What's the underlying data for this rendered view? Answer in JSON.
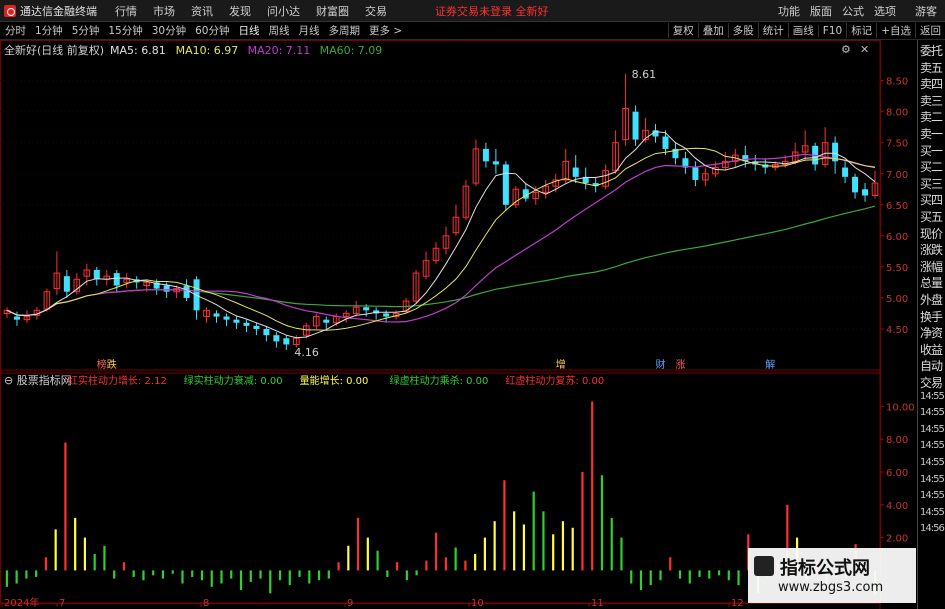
{
  "menubar": {
    "app_name": "通达信金融终端",
    "items": [
      "行情",
      "市场",
      "资讯",
      "发现",
      "问小达",
      "财富圈",
      "交易"
    ],
    "warning": "证券交易未登录 全新好",
    "right_items": [
      "功能",
      "版面",
      "公式",
      "选项"
    ],
    "guest": "游客"
  },
  "toolbar": {
    "timeframes": [
      "分时",
      "1分钟",
      "5分钟",
      "15分钟",
      "30分钟",
      "60分钟",
      "日线",
      "周线",
      "月线",
      "多周期",
      "更多 >"
    ],
    "active": "日线",
    "right_buttons": [
      "复权",
      "叠加",
      "多股",
      "统计",
      "画线",
      "F10",
      "标记",
      "+自选",
      "返回"
    ]
  },
  "chart_data": [
    {
      "type": "candlestick",
      "title": "全新好(日线 前复权)",
      "legend": [
        {
          "name": "MA5",
          "value": "6.81",
          "color": "#e0e0e0"
        },
        {
          "name": "MA10",
          "value": "6.97",
          "color": "#e6e65a"
        },
        {
          "name": "MA20",
          "value": "7.11",
          "color": "#c03ccf"
        },
        {
          "name": "MA60",
          "value": "7.09",
          "color": "#3ca83c"
        }
      ],
      "ylim": [
        4.0,
        8.8
      ],
      "yticks": [
        "8.50",
        "8.00",
        "7.50",
        "7.00",
        "6.50",
        "6.00",
        "5.50",
        "5.00",
        "4.50"
      ],
      "annotations": [
        {
          "text": "8.61"
        },
        {
          "text": "4.16"
        }
      ],
      "event_labels": [
        "榜",
        "跌",
        "增",
        "财",
        "涨",
        "解"
      ],
      "candles": [
        [
          4.75,
          4.8,
          4.68,
          4.85
        ],
        [
          4.7,
          4.65,
          4.55,
          4.78
        ],
        [
          4.65,
          4.7,
          4.6,
          4.8
        ],
        [
          4.72,
          4.8,
          4.65,
          4.85
        ],
        [
          4.82,
          5.1,
          4.78,
          5.15
        ],
        [
          5.15,
          5.4,
          5.05,
          5.75
        ],
        [
          5.35,
          5.1,
          5.0,
          5.45
        ],
        [
          5.1,
          5.3,
          5.05,
          5.4
        ],
        [
          5.35,
          5.45,
          5.2,
          5.55
        ],
        [
          5.45,
          5.3,
          5.2,
          5.5
        ],
        [
          5.3,
          5.35,
          5.2,
          5.45
        ],
        [
          5.4,
          5.2,
          5.1,
          5.45
        ],
        [
          5.25,
          5.3,
          5.15,
          5.4
        ],
        [
          5.3,
          5.25,
          5.15,
          5.35
        ],
        [
          5.2,
          5.25,
          5.1,
          5.3
        ],
        [
          5.25,
          5.15,
          5.05,
          5.3
        ],
        [
          5.2,
          5.1,
          5.0,
          5.25
        ],
        [
          5.1,
          5.15,
          5.0,
          5.2
        ],
        [
          5.2,
          5.0,
          4.95,
          5.3
        ],
        [
          5.3,
          4.8,
          4.65,
          5.35
        ],
        [
          4.7,
          4.8,
          4.6,
          4.85
        ],
        [
          4.75,
          4.7,
          4.6,
          4.8
        ],
        [
          4.7,
          4.65,
          4.55,
          4.75
        ],
        [
          4.65,
          4.6,
          4.5,
          4.7
        ],
        [
          4.6,
          4.55,
          4.45,
          4.65
        ],
        [
          4.55,
          4.5,
          4.4,
          4.6
        ],
        [
          4.5,
          4.4,
          4.3,
          4.55
        ],
        [
          4.4,
          4.3,
          4.2,
          4.45
        ],
        [
          4.35,
          4.25,
          4.16,
          4.4
        ],
        [
          4.25,
          4.35,
          4.2,
          4.4
        ],
        [
          4.4,
          4.55,
          4.35,
          4.6
        ],
        [
          4.55,
          4.7,
          4.5,
          4.75
        ],
        [
          4.65,
          4.6,
          4.5,
          4.7
        ],
        [
          4.6,
          4.7,
          4.55,
          4.75
        ],
        [
          4.7,
          4.75,
          4.6,
          4.8
        ],
        [
          4.75,
          4.85,
          4.7,
          4.95
        ],
        [
          4.85,
          4.8,
          4.7,
          4.9
        ],
        [
          4.8,
          4.75,
          4.65,
          4.85
        ],
        [
          4.75,
          4.7,
          4.6,
          4.8
        ],
        [
          4.7,
          4.75,
          4.65,
          4.8
        ],
        [
          4.78,
          4.95,
          4.75,
          5.0
        ],
        [
          4.95,
          5.4,
          4.9,
          5.45
        ],
        [
          5.35,
          5.6,
          5.3,
          5.75
        ],
        [
          5.6,
          5.8,
          5.55,
          5.9
        ],
        [
          5.8,
          6.0,
          5.7,
          6.15
        ],
        [
          6.05,
          6.3,
          6.0,
          6.5
        ],
        [
          6.3,
          6.8,
          6.25,
          6.9
        ],
        [
          6.85,
          7.4,
          6.8,
          7.55
        ],
        [
          7.4,
          7.2,
          7.1,
          7.5
        ],
        [
          7.2,
          7.15,
          7.0,
          7.4
        ],
        [
          7.15,
          6.5,
          6.4,
          7.2
        ],
        [
          6.5,
          6.75,
          6.45,
          6.8
        ],
        [
          6.75,
          6.6,
          6.55,
          6.85
        ],
        [
          6.6,
          6.7,
          6.5,
          6.8
        ],
        [
          6.7,
          6.8,
          6.6,
          6.9
        ],
        [
          6.8,
          6.9,
          6.7,
          7.0
        ],
        [
          6.9,
          7.2,
          6.85,
          7.4
        ],
        [
          7.1,
          6.95,
          6.85,
          7.3
        ],
        [
          6.95,
          6.85,
          6.75,
          7.1
        ],
        [
          6.85,
          6.8,
          6.7,
          6.95
        ],
        [
          6.8,
          7.05,
          6.75,
          7.15
        ],
        [
          7.05,
          7.5,
          7.0,
          7.7
        ],
        [
          7.55,
          8.05,
          7.45,
          8.61
        ],
        [
          8.0,
          7.55,
          7.45,
          8.1
        ],
        [
          7.55,
          7.7,
          7.5,
          7.9
        ],
        [
          7.7,
          7.6,
          7.5,
          7.8
        ],
        [
          7.6,
          7.4,
          7.3,
          7.7
        ],
        [
          7.4,
          7.25,
          7.15,
          7.5
        ],
        [
          7.25,
          7.1,
          7.0,
          7.35
        ],
        [
          7.1,
          6.9,
          6.8,
          7.2
        ],
        [
          6.9,
          7.0,
          6.8,
          7.1
        ],
        [
          7.0,
          7.1,
          6.95,
          7.2
        ],
        [
          7.1,
          7.2,
          7.05,
          7.35
        ],
        [
          7.2,
          7.3,
          7.1,
          7.4
        ],
        [
          7.3,
          7.2,
          7.1,
          7.45
        ],
        [
          7.2,
          7.15,
          7.05,
          7.3
        ],
        [
          7.15,
          7.1,
          7.0,
          7.25
        ],
        [
          7.1,
          7.15,
          7.05,
          7.2
        ],
        [
          7.15,
          7.2,
          7.1,
          7.3
        ],
        [
          7.2,
          7.35,
          7.15,
          7.5
        ],
        [
          7.35,
          7.45,
          7.2,
          7.7
        ],
        [
          7.45,
          7.15,
          7.05,
          7.5
        ],
        [
          7.15,
          7.5,
          7.1,
          7.75
        ],
        [
          7.5,
          7.2,
          7.0,
          7.6
        ],
        [
          7.1,
          6.95,
          6.85,
          7.2
        ],
        [
          6.95,
          6.7,
          6.6,
          7.0
        ],
        [
          6.75,
          6.65,
          6.55,
          6.85
        ],
        [
          6.65,
          6.85,
          6.6,
          7.05
        ]
      ]
    },
    {
      "type": "bar",
      "title": "股票指标网",
      "legend": [
        {
          "name": "红实柱动力增长",
          "value": "2.12",
          "color": "#ff3030"
        },
        {
          "name": "绿实柱动力衰减",
          "value": "0.00",
          "color": "#30d030"
        },
        {
          "name": "量能增长",
          "value": "0.00",
          "color": "#ffff40"
        },
        {
          "name": "绿虚柱动力乘杀",
          "value": "0.00",
          "color": "#30d030"
        },
        {
          "name": "红虚柱动力复苏",
          "value": "0.00",
          "color": "#ff3030"
        }
      ],
      "ylim": [
        -1.5,
        11.0
      ],
      "yticks": [
        "10.00",
        "8.00",
        "6.00",
        "4.00",
        "2.00"
      ],
      "bars": [
        {
          "v": -1.0,
          "c": "g"
        },
        {
          "v": -0.8,
          "c": "g"
        },
        {
          "v": -0.5,
          "c": "g"
        },
        {
          "v": -0.4,
          "c": "g"
        },
        {
          "v": 0.8,
          "c": "r"
        },
        {
          "v": 2.5,
          "c": "y"
        },
        {
          "v": 7.8,
          "c": "r"
        },
        {
          "v": 3.2,
          "c": "y"
        },
        {
          "v": 2.0,
          "c": "y"
        },
        {
          "v": 1.0,
          "c": "g"
        },
        {
          "v": 1.5,
          "c": "g"
        },
        {
          "v": -0.5,
          "c": "g"
        },
        {
          "v": 0.5,
          "c": "r"
        },
        {
          "v": -0.4,
          "c": "g"
        },
        {
          "v": -0.6,
          "c": "g"
        },
        {
          "v": -0.3,
          "c": "g"
        },
        {
          "v": -0.5,
          "c": "g"
        },
        {
          "v": -0.2,
          "c": "g"
        },
        {
          "v": -0.8,
          "c": "g"
        },
        {
          "v": -0.4,
          "c": "g"
        },
        {
          "v": -0.6,
          "c": "g"
        },
        {
          "v": -1.0,
          "c": "g"
        },
        {
          "v": -0.8,
          "c": "g"
        },
        {
          "v": -0.5,
          "c": "g"
        },
        {
          "v": -1.2,
          "c": "g"
        },
        {
          "v": -0.7,
          "c": "g"
        },
        {
          "v": -0.5,
          "c": "g"
        },
        {
          "v": -1.4,
          "c": "g"
        },
        {
          "v": -0.6,
          "c": "g"
        },
        {
          "v": -0.9,
          "c": "g"
        },
        {
          "v": -0.4,
          "c": "g"
        },
        {
          "v": -0.8,
          "c": "g"
        },
        {
          "v": -0.6,
          "c": "g"
        },
        {
          "v": -0.5,
          "c": "g"
        },
        {
          "v": 0.5,
          "c": "r"
        },
        {
          "v": 1.5,
          "c": "y"
        },
        {
          "v": 3.2,
          "c": "r"
        },
        {
          "v": 2.0,
          "c": "y"
        },
        {
          "v": 1.2,
          "c": "g"
        },
        {
          "v": -0.4,
          "c": "g"
        },
        {
          "v": 0.5,
          "c": "r"
        },
        {
          "v": -0.6,
          "c": "g"
        },
        {
          "v": -0.3,
          "c": "g"
        },
        {
          "v": 0.6,
          "c": "r"
        },
        {
          "v": 2.3,
          "c": "r"
        },
        {
          "v": 0.8,
          "c": "r"
        },
        {
          "v": 1.4,
          "c": "g"
        },
        {
          "v": 0.6,
          "c": "r"
        },
        {
          "v": 1.0,
          "c": "y"
        },
        {
          "v": 2.0,
          "c": "y"
        },
        {
          "v": 3.0,
          "c": "y"
        },
        {
          "v": 5.5,
          "c": "r"
        },
        {
          "v": 3.6,
          "c": "y"
        },
        {
          "v": 2.8,
          "c": "y"
        },
        {
          "v": 4.8,
          "c": "g"
        },
        {
          "v": 3.6,
          "c": "g"
        },
        {
          "v": 2.2,
          "c": "y"
        },
        {
          "v": 3.0,
          "c": "y"
        },
        {
          "v": 2.6,
          "c": "y"
        },
        {
          "v": 6.0,
          "c": "r"
        },
        {
          "v": 10.3,
          "c": "r"
        },
        {
          "v": 5.8,
          "c": "g"
        },
        {
          "v": 3.2,
          "c": "g"
        },
        {
          "v": 2.0,
          "c": "g"
        },
        {
          "v": -0.8,
          "c": "g"
        },
        {
          "v": -1.2,
          "c": "g"
        },
        {
          "v": -0.9,
          "c": "g"
        },
        {
          "v": -0.6,
          "c": "g"
        },
        {
          "v": 0.8,
          "c": "r"
        },
        {
          "v": -0.5,
          "c": "g"
        },
        {
          "v": -0.8,
          "c": "g"
        },
        {
          "v": -0.4,
          "c": "g"
        },
        {
          "v": -0.5,
          "c": "g"
        },
        {
          "v": -0.3,
          "c": "g"
        },
        {
          "v": -0.6,
          "c": "g"
        },
        {
          "v": -0.9,
          "c": "g"
        },
        {
          "v": 2.2,
          "c": "r"
        },
        {
          "v": -1.4,
          "c": "g"
        },
        {
          "v": -0.4,
          "c": "g"
        },
        {
          "v": 0.6,
          "c": "r"
        },
        {
          "v": 4.0,
          "c": "r"
        },
        {
          "v": 2.0,
          "c": "y"
        },
        {
          "v": -0.6,
          "c": "g"
        },
        {
          "v": 0.5,
          "c": "r"
        },
        {
          "v": -0.8,
          "c": "g"
        },
        {
          "v": -0.4,
          "c": "g"
        },
        {
          "v": -0.5,
          "c": "g"
        },
        {
          "v": 1.6,
          "c": "r"
        },
        {
          "v": -0.3,
          "c": "g"
        },
        {
          "v": -1.5,
          "c": "g"
        }
      ]
    }
  ],
  "xaxis": {
    "labels": [
      "2024年",
      "7",
      "8",
      "9",
      "10",
      "11",
      "12"
    ]
  },
  "sidebar": {
    "items": [
      "委托",
      "卖五",
      "卖四",
      "卖三",
      "卖二",
      "卖一",
      "买一",
      "买二",
      "买三",
      "买四",
      "买五",
      "现价",
      "涨跌",
      "涨幅",
      "总量",
      "外盘",
      "换手",
      "净资",
      "收益",
      "自动",
      "交易",
      "14:55",
      "14:55",
      "14:55",
      "14:55",
      "14:55",
      "14:55",
      "14:55",
      "14:55",
      "14:56"
    ]
  },
  "watermark": {
    "title": "指标公式网",
    "url": "www.zbgs3.com"
  },
  "colors": {
    "up": "#ff3030",
    "down": "#40e0ff",
    "ma5": "#e0e0e0",
    "ma10": "#e6e65a",
    "ma20": "#c03ccf",
    "ma60": "#3ca83c"
  }
}
